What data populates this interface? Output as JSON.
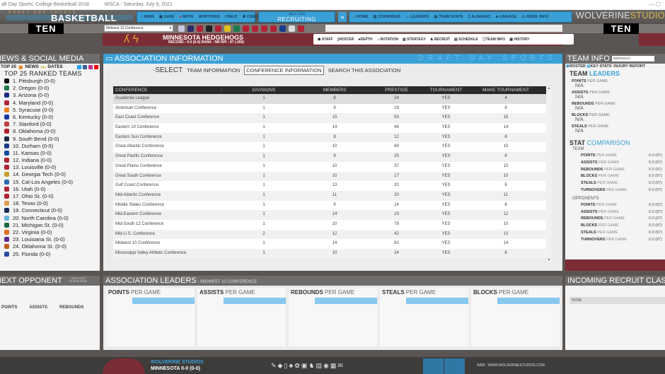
{
  "titlebar": {
    "app": "aft Day Sports: College Basketball 2018",
    "league": "WSCA - Saturday, July 9, 2021",
    "controls": "—   ☐"
  },
  "logo": {
    "brand": "DRAFT DAY SPORTS",
    "product": "BASKETBALL"
  },
  "main_menu": [
    "MAIN",
    "SAVE",
    "MUTE",
    "OPTIONS",
    "HELP",
    "CREDITS"
  ],
  "recruiting": {
    "date": "July 9, 2021",
    "label": "RECRUITING",
    "forward": "»"
  },
  "nav_menu": [
    "HOME",
    "STANDINGS",
    "LEADERS",
    "TEAM STATS",
    "ALMANAC",
    "LINEAGE",
    "ASSN. INFO"
  ],
  "studio": {
    "a": "WOLVERINE",
    "b": "STUDIOS"
  },
  "conference_logo": "TEN",
  "conference_select": {
    "value": "Midwest 10 Conference",
    "chevron": "▾"
  },
  "team_logo_colors": [
    "#c8c8e0",
    "#2a2a6a",
    "#b22234",
    "#222",
    "#b22234",
    "#e0c020",
    "#1d7a4a",
    "#b22234",
    "#b22234",
    "#b22234",
    "#b22234",
    "#1a3a8a",
    "#ddd",
    "#b22234"
  ],
  "team": {
    "name": "MINNESOTA HEDGEHOGS",
    "record": "RECORD : 0-0 (0-0)   RANK : NR   RPI : 87 (.000)"
  },
  "team_nav": [
    "STAFF",
    "ROSTER",
    "DEPTH",
    "ROTATION",
    "STRATEGY",
    "RECRUIT",
    "SCHEDULE",
    "TEAM INFO",
    "HISTORY"
  ],
  "news": {
    "title": "NEWS & SOCIAL MEDIA",
    "tabs": [
      "TOP 25",
      "NEWS",
      "DATES"
    ],
    "top25_title": "TOP 25 RANKED TEAMS",
    "teams": [
      "1. Pittsburgh  (0-0)",
      "2. Oregon  (0-0)",
      "3. Arizona  (0-0)",
      "4. Maryland  (0-0)",
      "5. Syracuse  (0-0)",
      "6. Kentucky  (0-0)",
      "7. Stanford  (0-0)",
      "8. Oklahoma  (0-0)",
      "9. South Bend  (0-0)",
      "10. Durham  (0-0)",
      "11. Kansas  (0-0)",
      "12. Indiana  (0-0)",
      "13. Louisville  (0-0)",
      "14. Georgia Tech  (0-0)",
      "15. Cal-Los Angeles  (0-0)",
      "16. Utah  (0-0)",
      "17. Ohio St.  (0-0)",
      "18. Texas  (0-0)",
      "19. Connecticut  (0-0)",
      "20. North Carolina  (0-0)",
      "21. Michigan St.  (0-0)",
      "22. Virginia  (0-0)",
      "23. Louisiana St.  (0-0)",
      "24. Oklahoma St.  (0-0)",
      "25. Florida  (0-0)"
    ],
    "team_colors": [
      "#111",
      "#1d7a4a",
      "#1a2a8a",
      "#b22234",
      "#f08020",
      "#1a3aa0",
      "#c04040",
      "#b22234",
      "#1a2a4a",
      "#1a3a8a",
      "#1a4aa0",
      "#b22234",
      "#b22234",
      "#c8a030",
      "#2a6ab0",
      "#b22234",
      "#b22234",
      "#e0a050",
      "#1a2a5a",
      "#6ab0e0",
      "#1d6a4a",
      "#e07020",
      "#5a2a8a",
      "#c06020",
      "#2a4aa0"
    ]
  },
  "assoc": {
    "title": "ASSOCIATION INFORMATION",
    "watermark": "DRAFT DAY SPORTS",
    "select_label": "SELECT",
    "options": [
      "TEAM INFORMATION",
      "CONFERENCE INFORMATION",
      "SEARCH THIS ASSOCIATION"
    ],
    "columns": [
      "CONFERENCE",
      "DIVISIONS",
      "MEMBERS",
      "PRESTIGE",
      "TOURNAMENT",
      "MAKE TOURNAMENT"
    ],
    "rows": [
      [
        "Academia League",
        "1",
        "8",
        "24",
        "YES",
        "4"
      ],
      [
        "American Conference",
        "1",
        "9",
        "19",
        "YES",
        "8"
      ],
      [
        "East Coast Conference",
        "1",
        "15",
        "93",
        "YES",
        "15"
      ],
      [
        "Eastern 10 Conference",
        "1",
        "14",
        "46",
        "YES",
        "14"
      ],
      [
        "Eastern Sun Conference",
        "1",
        "8",
        "12",
        "YES",
        "8"
      ],
      [
        "Great Atlantic Conference",
        "1",
        "10",
        "69",
        "YES",
        "10"
      ],
      [
        "Great Pacific Conference",
        "1",
        "9",
        "25",
        "YES",
        "8"
      ],
      [
        "Great Plains Conference",
        "1",
        "10",
        "37",
        "YES",
        "10"
      ],
      [
        "Great South Conference",
        "1",
        "10",
        "17",
        "YES",
        "10"
      ],
      [
        "Gulf Coast Conference",
        "1",
        "13",
        "20",
        "YES",
        "8"
      ],
      [
        "Mid-Atlantic Conference",
        "1",
        "11",
        "20",
        "YES",
        "11"
      ],
      [
        "Middle States Conference",
        "1",
        "9",
        "14",
        "YES",
        "8"
      ],
      [
        "Mid-Eastern Conference",
        "1",
        "14",
        "19",
        "YES",
        "12"
      ],
      [
        "Mid-South 12 Conference",
        "1",
        "10",
        "78",
        "YES",
        "10"
      ],
      [
        "Mid-U.S. Conference",
        "2",
        "12",
        "42",
        "YES",
        "12"
      ],
      [
        "Midwest 10 Conference",
        "1",
        "14",
        "81",
        "YES",
        "14"
      ],
      [
        "Mississippi Valley Athletic Conference",
        "1",
        "10",
        "24",
        "YES",
        "8"
      ]
    ]
  },
  "team_info": {
    "title": "TEAM INFO",
    "team_select": "KENTUCKY",
    "tabs": [
      "ROSTER",
      "KEY STATS",
      "INJURY REPORT"
    ],
    "leaders_title": [
      "TEAM",
      "LEADERS"
    ],
    "per_game": "PER GAME",
    "leaders": [
      {
        "stat": "POINTS",
        "value": "N/A"
      },
      {
        "stat": "ASSISTS",
        "value": "N/A"
      },
      {
        "stat": "REBOUNDS",
        "value": "N/A"
      },
      {
        "stat": "BLOCKS",
        "value": "N/A"
      },
      {
        "stat": "STEALS",
        "value": "N/A"
      }
    ],
    "comparison_title": [
      "STAT",
      "COMPARISON"
    ],
    "team_label": "TEAM",
    "opp_label": "OPPONENTS",
    "team_stats": [
      [
        "POINTS",
        "0.0 (87)"
      ],
      [
        "ASSISTS",
        "0.0 (87)"
      ],
      [
        "REBOUNDS",
        "0.0 (87)"
      ],
      [
        "BLOCKS",
        "0.0 (87)"
      ],
      [
        "STEALS",
        "0.0 (87)"
      ],
      [
        "TURNOVERS",
        "0.0 (87)"
      ]
    ],
    "opp_stats": [
      [
        "POINTS",
        "0.0 (87)"
      ],
      [
        "ASSISTS",
        "0.0 (87)"
      ],
      [
        "REBOUNDS",
        "0.0 (87)"
      ],
      [
        "BLOCKS",
        "0.0 (87)"
      ],
      [
        "STEALS",
        "0.0 (87)"
      ],
      [
        "TURNOVERS",
        "0.0 (87)"
      ]
    ]
  },
  "next_opponent": {
    "title": "NEXT OPPONENT",
    "hint": "CLICK LOGO TO VIEW TEAM",
    "cols": [
      "POINTS",
      "ASSISTS",
      "REBOUNDS"
    ]
  },
  "assoc_leaders": {
    "title": "ASSOCIATION LEADERS",
    "conference": " - MIDWEST 10 CONFERENCE",
    "per_game": "PER GAME",
    "stats": [
      "POINTS",
      "ASSISTS",
      "REBOUNDS",
      "STEALS",
      "BLOCKS"
    ]
  },
  "incoming": {
    "title": "INCOMING RECRUIT CLASS",
    "value": "NONE"
  },
  "footer": {
    "studio": "WOLVERINE STUDIOS",
    "team": "MINNESOTA 0-0 (0-0)",
    "web": "WEB : WWW.WOLVERINESTUDIOS.COM",
    "icons": [
      "✎",
      "◆",
      "▯",
      "♣",
      "✿",
      "▣",
      "♞",
      "▤",
      "◉",
      "▦",
      "✉"
    ]
  }
}
